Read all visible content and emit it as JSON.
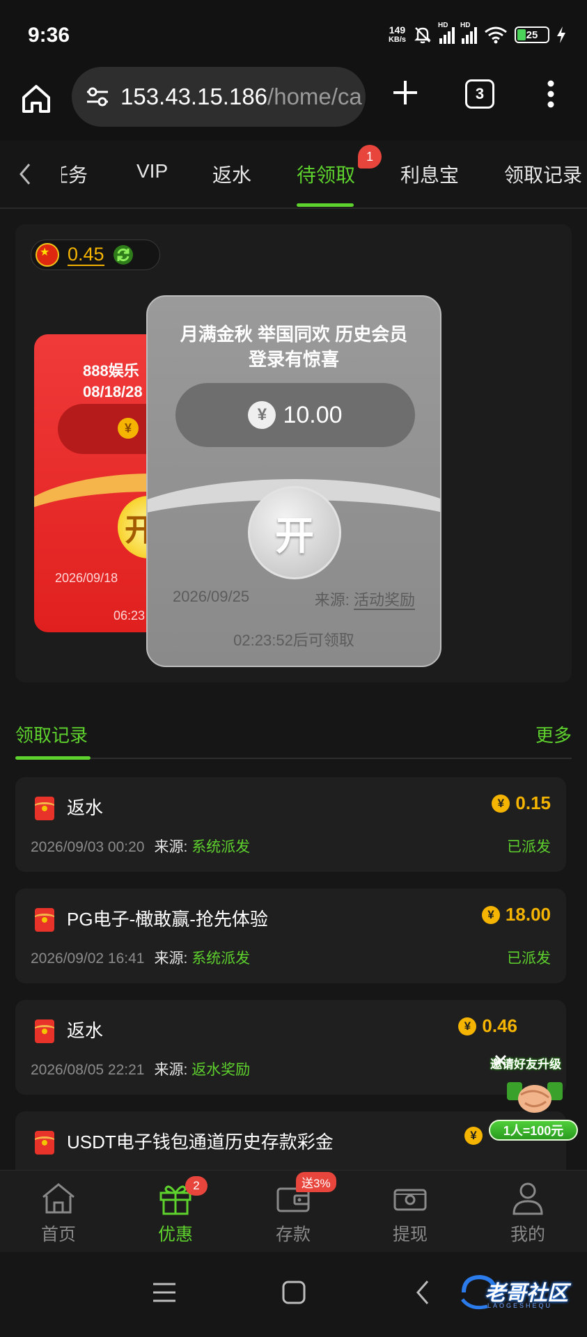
{
  "status_bar": {
    "time": "9:36",
    "net_speed_value": "149",
    "net_speed_unit": "KB/s",
    "signal1_label": "HD",
    "signal2_label": "HD",
    "battery": "25",
    "icons": [
      "mute-bell-icon",
      "signal-icon",
      "signal-icon",
      "wifi-icon",
      "battery-icon",
      "charging-icon"
    ]
  },
  "browser": {
    "url_host": "153.43.15.186",
    "url_path": "/home/ca",
    "tab_count": "3",
    "icons": [
      "home-icon",
      "site-settings-icon",
      "plus-icon",
      "tabs-icon",
      "menu-icon"
    ]
  },
  "category_tabs": {
    "items": [
      {
        "label": "任务"
      },
      {
        "label": "VIP"
      },
      {
        "label": "返水"
      },
      {
        "label": "待领取"
      },
      {
        "label": "利息宝"
      },
      {
        "label": "领取记录"
      }
    ],
    "active_index": 3,
    "badge": "1"
  },
  "balance": {
    "value": "0.45"
  },
  "red_envelope": {
    "title_line1": "888娱乐",
    "title_line2": "08/18/28",
    "coin": "¥",
    "open_label": "开",
    "date": "2026/09/18",
    "time": "06:23"
  },
  "gray_envelope": {
    "title_line1": "月满金秋 举国同欢 历史会员",
    "title_line2": "登录有惊喜",
    "currency": "¥",
    "amount": "10.00",
    "open_label": "开",
    "date": "2026/09/25",
    "source_label": "来源:",
    "source_value": "活动奖励",
    "countdown": "02:23:52后可领取"
  },
  "records_header": {
    "title": "领取记录",
    "more": "更多"
  },
  "records": [
    {
      "name": "返水",
      "amount": "0.15",
      "date": "2026/09/03 00:20",
      "source_label": "来源:",
      "source": "系统派发",
      "status": "已派发"
    },
    {
      "name": "PG电子-橄敢赢-抢先体验",
      "amount": "18.00",
      "date": "2026/09/02 16:41",
      "source_label": "来源:",
      "source": "系统派发",
      "status": "已派发"
    },
    {
      "name": "返水",
      "amount": "0.46",
      "date": "2026/08/05 22:21",
      "source_label": "来源:",
      "source": "返水奖励",
      "status": ""
    },
    {
      "name": "USDT电子钱包通道历史存款彩金",
      "amount": "",
      "date": "",
      "source_label": "",
      "source": "",
      "status": ""
    }
  ],
  "coin_symbol": "¥",
  "promo": {
    "title": "邀请好友升级",
    "badge": "1人=100元"
  },
  "bottom_nav": {
    "items": [
      {
        "label": "首页"
      },
      {
        "label": "优惠"
      },
      {
        "label": "存款"
      },
      {
        "label": "提现"
      },
      {
        "label": "我的"
      }
    ],
    "active_index": 1,
    "promo_badge": "2",
    "deposit_tag": "送3%"
  },
  "watermark": {
    "text": "老哥社区",
    "sub": "LAOGESHEQU"
  },
  "colors": {
    "accent": "#5ed22d",
    "gold": "#f5b400",
    "badge_red": "#e8453c",
    "envelope_red": "#e0201e",
    "background": "#161616"
  }
}
